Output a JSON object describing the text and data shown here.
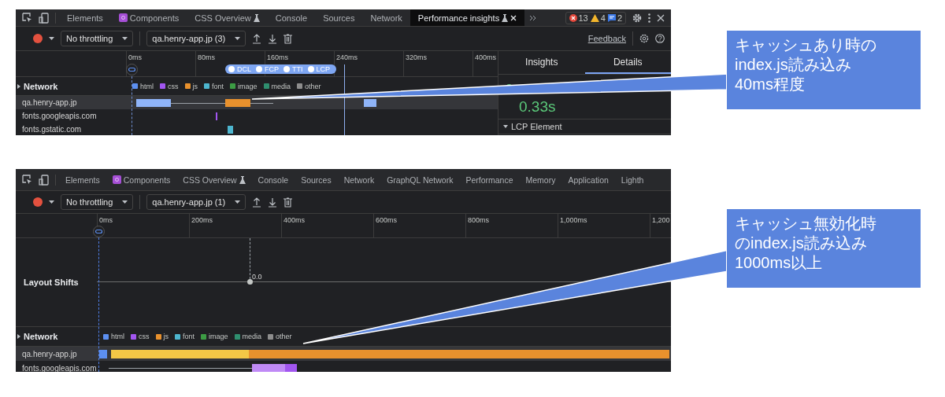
{
  "panels": [
    {
      "tabs": [
        {
          "label": "Elements",
          "kind": "plain",
          "selected": false
        },
        {
          "label": "Components",
          "kind": "components",
          "selected": false
        },
        {
          "label": "CSS Overview",
          "kind": "experiment",
          "selected": false
        },
        {
          "label": "Console",
          "kind": "plain",
          "selected": false
        },
        {
          "label": "Sources",
          "kind": "plain",
          "selected": false
        },
        {
          "label": "Network",
          "kind": "plain",
          "selected": false
        },
        {
          "label": "Performance insights",
          "kind": "experiment",
          "selected": true
        }
      ],
      "badges": [
        {
          "kind": "error",
          "count": "13"
        },
        {
          "kind": "warning",
          "count": "4"
        },
        {
          "kind": "message",
          "count": "2"
        }
      ],
      "throttling": "No throttling",
      "recording": "qa.henry-app.jp (3)",
      "feedback": "Feedback",
      "ticks": [
        "0ms",
        "80ms",
        "160ms",
        "240ms",
        "320ms",
        "400ms"
      ],
      "markers": [
        "DCL",
        "FCP",
        "TTI",
        "LCP"
      ],
      "network": {
        "label": "Network",
        "legend": [
          {
            "label": "html",
            "color": "#5c8ff0"
          },
          {
            "label": "css",
            "color": "#a256f0"
          },
          {
            "label": "js",
            "color": "#e8912d"
          },
          {
            "label": "font",
            "color": "#4db6cf"
          },
          {
            "label": "image",
            "color": "#3c9c44"
          },
          {
            "label": "media",
            "color": "#2f8f6f"
          },
          {
            "label": "other",
            "color": "#8d8d8d"
          }
        ],
        "rows": [
          {
            "host": "qa.henry-app.jp",
            "selected": true,
            "bars": [
              {
                "kind": "html"
              },
              {
                "kind": "js"
              },
              {
                "kind": "html"
              }
            ]
          },
          {
            "host": "fonts.googleapis.com",
            "selected": false,
            "bars": [
              {
                "kind": "css"
              }
            ]
          },
          {
            "host": "fonts.gstatic.com",
            "selected": false,
            "bars": [
              {
                "kind": "font"
              }
            ]
          }
        ]
      },
      "details": {
        "tabs": [
          {
            "label": "Insights",
            "selected": false
          },
          {
            "label": "Details",
            "selected": true
          }
        ],
        "metric": "0.33s",
        "section": {
          "label": "LCP Element",
          "expanded": true
        }
      }
    },
    {
      "tabs": [
        {
          "label": "Elements",
          "kind": "plain",
          "selected": false
        },
        {
          "label": "Components",
          "kind": "components",
          "selected": false
        },
        {
          "label": "CSS Overview",
          "kind": "experiment",
          "selected": false
        },
        {
          "label": "Console",
          "kind": "plain",
          "selected": false
        },
        {
          "label": "Sources",
          "kind": "plain",
          "selected": false
        },
        {
          "label": "Network",
          "kind": "plain",
          "selected": false
        },
        {
          "label": "GraphQL Network",
          "kind": "plain",
          "selected": false
        },
        {
          "label": "Performance",
          "kind": "plain",
          "selected": false
        },
        {
          "label": "Memory",
          "kind": "plain",
          "selected": false
        },
        {
          "label": "Application",
          "kind": "plain",
          "selected": false
        },
        {
          "label": "Lighth",
          "kind": "plain",
          "selected": false
        }
      ],
      "throttling": "No throttling",
      "recording": "qa.henry-app.jp (1)",
      "ticks": [
        "0ms",
        "200ms",
        "400ms",
        "600ms",
        "800ms",
        "1,000ms",
        "1,200"
      ],
      "layout_shifts": {
        "label": "Layout Shifts",
        "value": "0.0"
      },
      "network": {
        "label": "Network",
        "legend": [
          {
            "label": "html",
            "color": "#5c8ff0"
          },
          {
            "label": "css",
            "color": "#a256f0"
          },
          {
            "label": "js",
            "color": "#e8912d"
          },
          {
            "label": "font",
            "color": "#4db6cf"
          },
          {
            "label": "image",
            "color": "#3c9c44"
          },
          {
            "label": "media",
            "color": "#2f8f6f"
          },
          {
            "label": "other",
            "color": "#8d8d8d"
          }
        ],
        "rows": [
          {
            "host": "qa.henry-app.jp",
            "selected": true,
            "bars": [
              {
                "kind": "html"
              },
              {
                "kind": "js"
              }
            ]
          },
          {
            "host": "fonts.googleapis.com",
            "selected": false,
            "bars": [
              {
                "kind": "css"
              }
            ]
          }
        ]
      }
    }
  ],
  "callouts": [
    {
      "lines": [
        "キャッシュあり時の",
        "index.js読み込み",
        "40ms程度"
      ]
    },
    {
      "lines": [
        "キャッシュ無効化時",
        "のindex.js読み込み",
        "1000ms以上"
      ]
    }
  ]
}
